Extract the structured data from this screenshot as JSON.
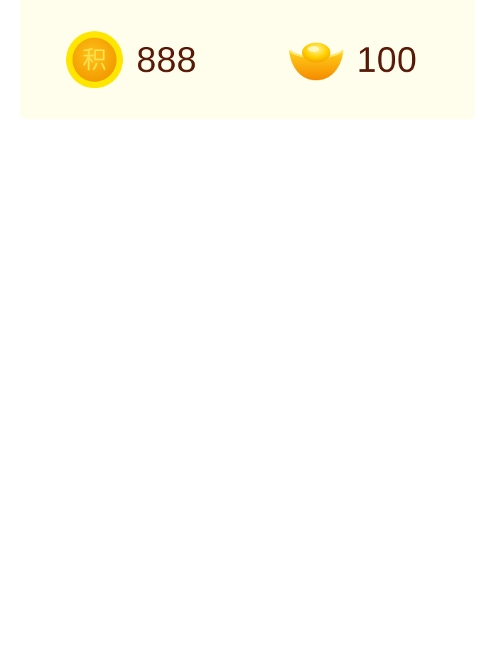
{
  "balances": {
    "points": {
      "icon": "points-coin-icon",
      "icon_glyph": "积",
      "value": "888"
    },
    "ingots": {
      "icon": "gold-ingot-icon",
      "value": "100"
    }
  },
  "colors": {
    "card_background": "#fffdeb",
    "value_text": "#5a1c08",
    "coin_outer": "#ffe000",
    "coin_inner": "#f7a800",
    "ingot_gold": "#ffb400"
  }
}
